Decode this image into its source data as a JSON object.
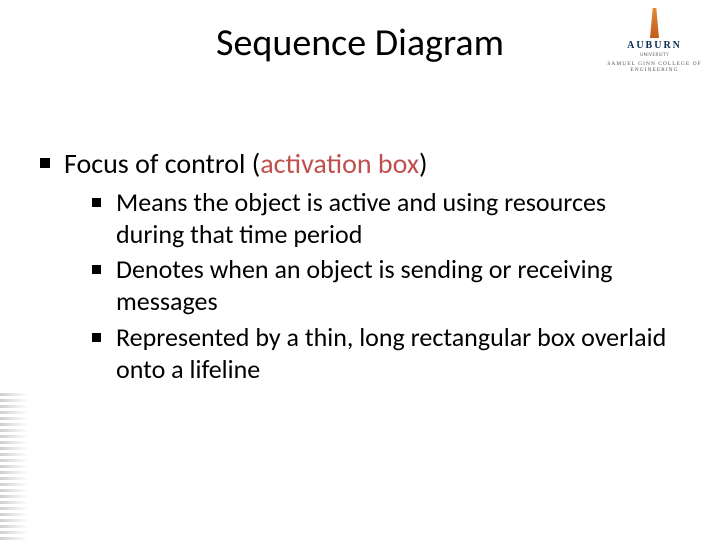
{
  "title": "Sequence Diagram",
  "logo": {
    "name": "AUBURN",
    "sub": "UNIVERSITY",
    "college": "SAMUEL GINN COLLEGE OF ENGINEERING"
  },
  "bullets": {
    "l1": {
      "pre": "Focus of control (",
      "hl": "activation box",
      "post": ")"
    },
    "l2": [
      "Means the object is active and using resources during that time period",
      "Denotes when an object is sending or receiving messages",
      "Represented by a thin, long rectangular box overlaid onto a lifeline"
    ]
  }
}
